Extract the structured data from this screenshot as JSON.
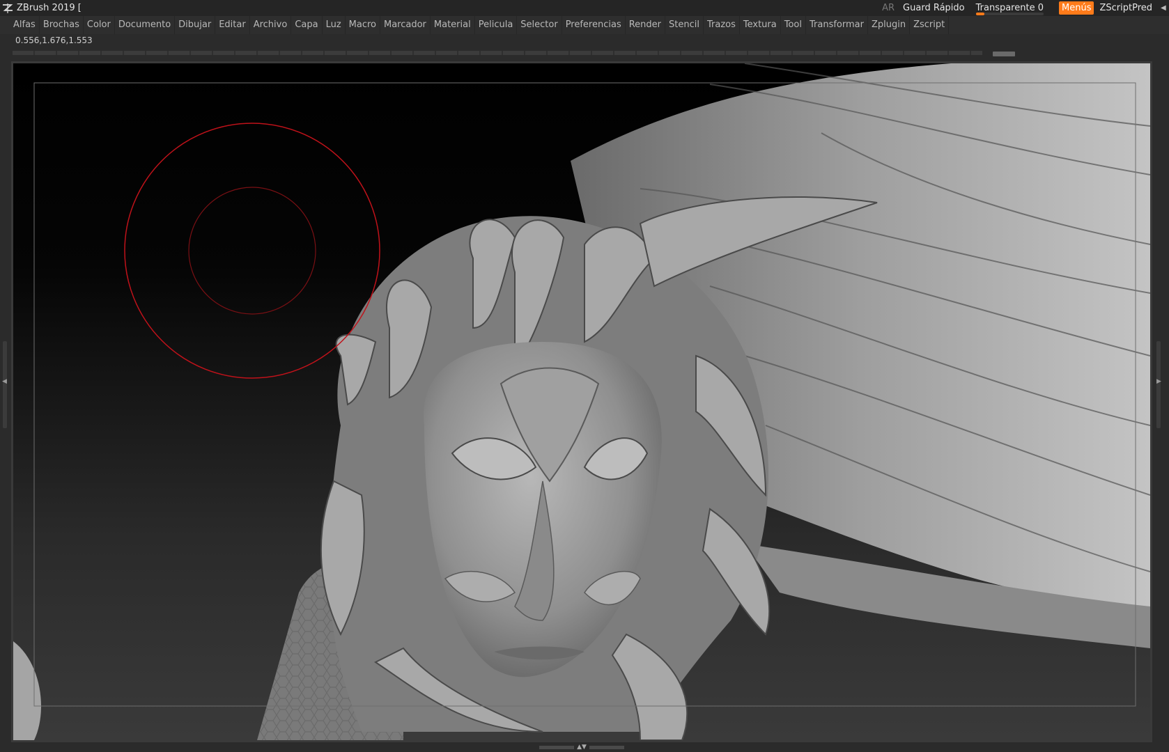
{
  "titlebar": {
    "app_title": "ZBrush 2019 [",
    "ar_label": "AR",
    "quick_save_label": "Guard Rápido",
    "transparent_label": "Transparente",
    "transparent_value": "0",
    "menus_label": "Menús",
    "zscript_label": "ZScriptPred",
    "collapse_icon": "chevron-left-icon"
  },
  "menubar": {
    "items": [
      "Alfas",
      "Brochas",
      "Color",
      "Documento",
      "Dibujar",
      "Editar",
      "Archivo",
      "Capa",
      "Luz",
      "Macro",
      "Marcador",
      "Material",
      "Pelicula",
      "Selector",
      "Preferencias",
      "Render",
      "Stencil",
      "Trazos",
      "Textura",
      "Tool",
      "Transformar",
      "Zplugin",
      "Zscript"
    ]
  },
  "status": {
    "coordinates": "0.556,1.676,1.553"
  },
  "colors": {
    "accent": "#ff7b1a",
    "brush_cursor": "#c0121a",
    "model_base": "#9a9a9a"
  },
  "canvas": {
    "model": "sculpted head with mask and flowing hair",
    "brush_cursor": "red-circle-brush-icon"
  }
}
